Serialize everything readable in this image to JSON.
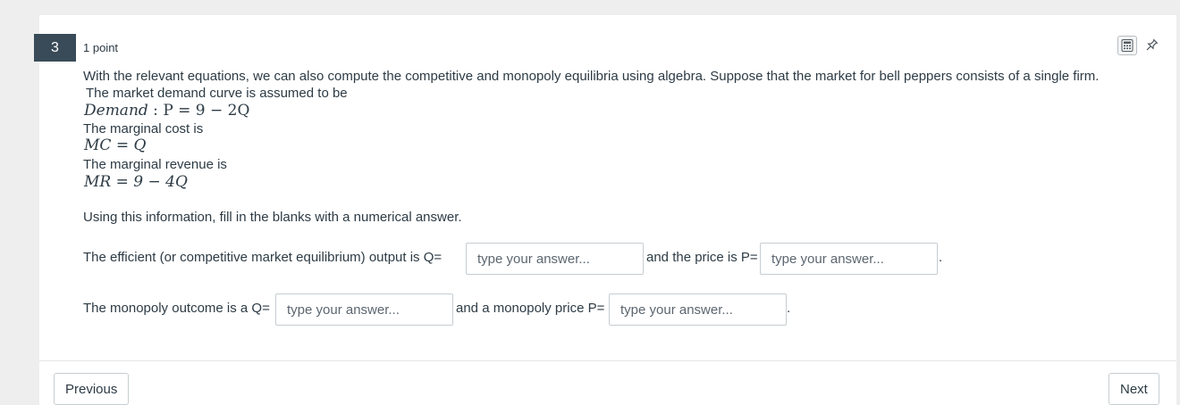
{
  "question": {
    "number": "3",
    "points": "1 point",
    "intro": "With the relevant equations, we can also compute the competitive and monopoly equilibria using algebra.  Suppose that the market for bell peppers consists of a single firm.",
    "demand_intro": "The market demand curve is assumed to be",
    "demand_eq_lhs": "Demand",
    "demand_eq_rest": " : P = 9 − 2Q",
    "mc_intro": "The marginal cost is",
    "mc_eq": "MC = Q",
    "mr_intro": "The marginal revenue is",
    "mr_eq": "MR = 9 − 4Q",
    "instruction": "Using this information, fill in the blanks with a numerical answer.",
    "line1_prefix": "The efficient (or competitive market equilibrium) output is Q=",
    "line1_middle": "and the price is P=",
    "line1_suffix": ".",
    "line2_prefix": "The monopoly outcome is a Q=",
    "line2_middle": "and a monopoly price P=",
    "line2_suffix": ".",
    "placeholder": "type your answer..."
  },
  "tools": {
    "calculator_icon": "calculator-icon",
    "pin_icon": "pin-icon"
  },
  "nav": {
    "previous": "Previous",
    "next": "Next"
  }
}
